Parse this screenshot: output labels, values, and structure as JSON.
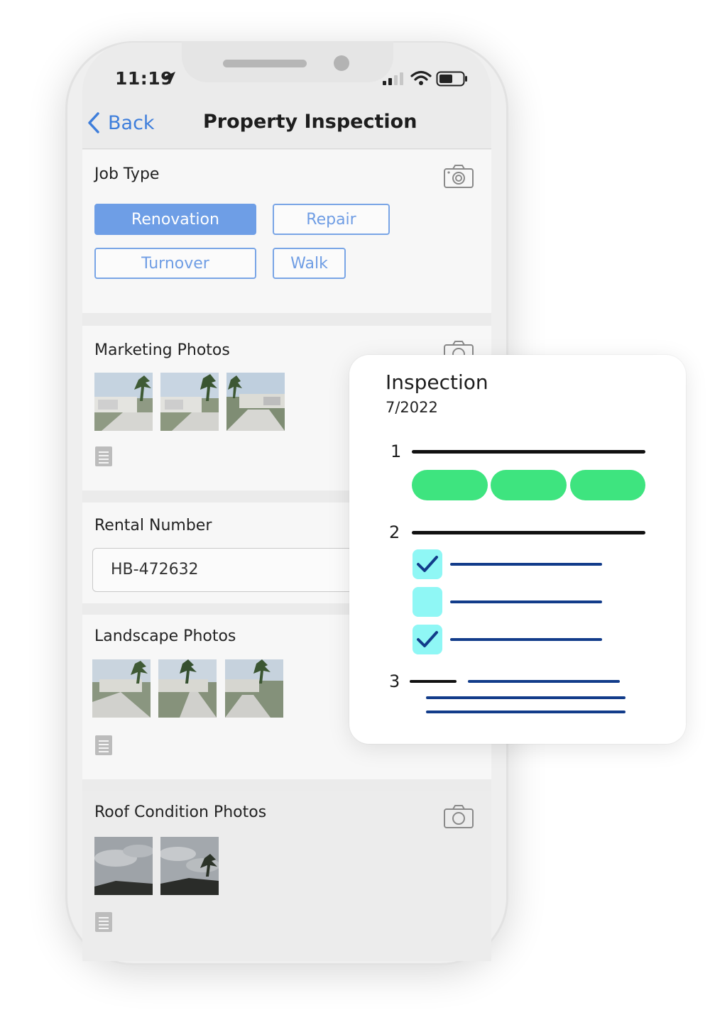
{
  "status": {
    "time": "11:19"
  },
  "nav": {
    "back_label": "Back",
    "title": "Property Inspection"
  },
  "job_type": {
    "title": "Job Type",
    "options": [
      "Renovation",
      "Repair",
      "Turnover",
      "Walk"
    ],
    "selected": "Renovation"
  },
  "marketing_photos": {
    "title": "Marketing Photos",
    "photo_count": 3
  },
  "rental": {
    "title": "Rental Number",
    "value": "HB-472632"
  },
  "landscape_photos": {
    "title": "Landscape Photos",
    "photo_count": 3
  },
  "roof_photos": {
    "title": "Roof Condition Photos",
    "photo_count": 2
  },
  "inspection_card": {
    "title": "Inspection",
    "date": "7/2022",
    "steps": [
      "1",
      "2",
      "3"
    ],
    "checklist": [
      true,
      false,
      true
    ]
  },
  "colors": {
    "accent_blue": "#6e9ee6",
    "link_blue": "#3e7edb",
    "pill_green": "#3ee47f",
    "line_navy": "#123c8a",
    "checkbox_cyan": "#8ff7f5"
  },
  "icons": {
    "back": "chevron-left-icon",
    "camera": "camera-icon",
    "note": "note-icon",
    "check": "check-icon",
    "location": "location-arrow-icon",
    "signal": "signal-icon",
    "wifi": "wifi-icon",
    "battery": "battery-icon"
  }
}
